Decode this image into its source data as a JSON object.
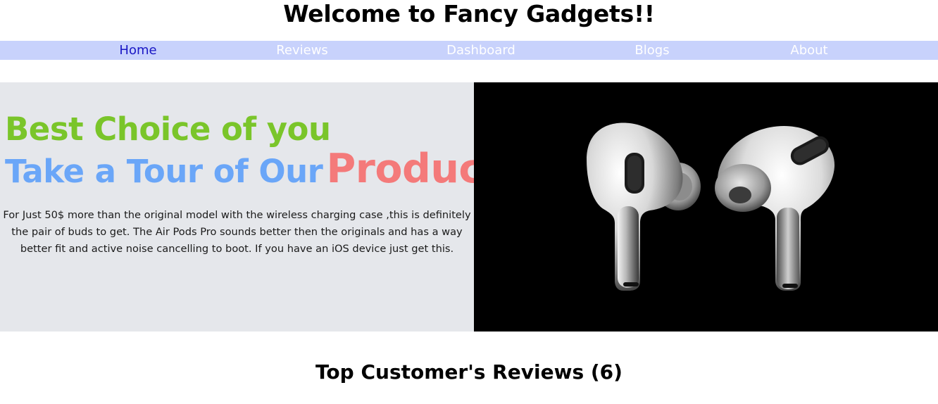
{
  "header": {
    "title": "Welcome to Fancy Gadgets!!"
  },
  "nav": {
    "items": [
      {
        "label": "Home",
        "active": true
      },
      {
        "label": "Reviews",
        "active": false
      },
      {
        "label": "Dashboard",
        "active": false
      },
      {
        "label": "Blogs",
        "active": false
      },
      {
        "label": "About",
        "active": false
      }
    ]
  },
  "hero": {
    "line1": "Best Choice of you",
    "line2_prefix": "Take a Tour of Our",
    "line2_highlight": "Product",
    "description": "For Just 50$ more than the original model with the wireless charging case ,this is definitely the pair of buds to get. The Air Pods Pro sounds better then the originals and has a way better fit and active noise cancelling to boot. If you have an iOS device just get this."
  },
  "reviews": {
    "heading": "Top Customer's Reviews (6)"
  },
  "colors": {
    "nav_bg": "#c8d2fc",
    "nav_active": "#1a17c4",
    "line1": "#7ac52a",
    "line2": "#6aa6f8",
    "highlight": "#f47a7a",
    "hero_bg": "#e5e7eb"
  }
}
